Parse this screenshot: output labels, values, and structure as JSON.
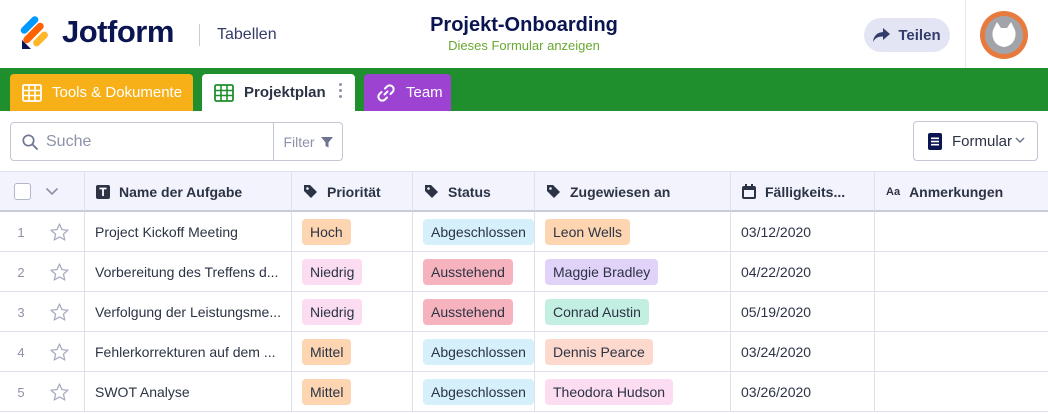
{
  "header": {
    "brand": "Jotform",
    "section": "Tabellen",
    "title": "Projekt-Onboarding",
    "subtitle": "Dieses Formular anzeigen",
    "share_label": "Teilen"
  },
  "tabs": [
    {
      "label": "Tools & Dokumente",
      "color": "#f8b019",
      "icon": "table-icon"
    },
    {
      "label": "Projektplan",
      "color": "#ffffff",
      "icon": "table-icon",
      "active": true
    },
    {
      "label": "Team",
      "color": "#9c43d1",
      "icon": "link-icon"
    }
  ],
  "toolbar": {
    "search_placeholder": "Suche",
    "filter_label": "Filter",
    "form_label": "Formular"
  },
  "columns": [
    {
      "label": "Name der Aufgabe",
      "icon": "text-type-icon"
    },
    {
      "label": "Priorität",
      "icon": "tag-icon"
    },
    {
      "label": "Status",
      "icon": "tag-icon"
    },
    {
      "label": "Zugewiesen an",
      "icon": "tag-icon"
    },
    {
      "label": "Fälligkeits...",
      "icon": "calendar-icon"
    },
    {
      "label": "Anmerkungen",
      "icon": "aa-icon"
    }
  ],
  "rows": [
    {
      "num": "1",
      "task": "Project Kickoff Meeting",
      "priority": "Hoch",
      "status": "Abgeschlossen",
      "assignee": "Leon Wells",
      "due": "03/12/2020",
      "notes": ""
    },
    {
      "num": "2",
      "task": "Vorbereitung des Treffens d...",
      "priority": "Niedrig",
      "status": "Ausstehend",
      "assignee": "Maggie Bradley",
      "due": "04/22/2020",
      "notes": ""
    },
    {
      "num": "3",
      "task": "Verfolgung der Leistungsme...",
      "priority": "Niedrig",
      "status": "Ausstehend",
      "assignee": "Conrad Austin",
      "due": "05/19/2020",
      "notes": ""
    },
    {
      "num": "4",
      "task": "Fehlerkorrekturen auf dem ...",
      "priority": "Mittel",
      "status": "Abgeschlossen",
      "assignee": "Dennis Pearce",
      "due": "03/24/2020",
      "notes": ""
    },
    {
      "num": "5",
      "task": "SWOT Analyse",
      "priority": "Mittel",
      "status": "Abgeschlossen",
      "assignee": "Theodora Hudson",
      "due": "03/26/2020",
      "notes": ""
    }
  ],
  "colors": {
    "priority": {
      "Hoch": "#fdd5b1",
      "Niedrig": "#fbdcf0",
      "Mittel": "#fdd5b1"
    },
    "status": {
      "Abgeschlossen": "#d5f0fb",
      "Ausstehend": "#f7b3bd"
    },
    "assignee": {
      "Leon Wells": "#fdd5b1",
      "Maggie Bradley": "#e0d2f8",
      "Conrad Austin": "#c3efe3",
      "Dennis Pearce": "#fdd8cc",
      "Theodora Hudson": "#fbdcf0"
    },
    "header_accent": "#1f8f2e",
    "brand_navy": "#0a1551"
  }
}
